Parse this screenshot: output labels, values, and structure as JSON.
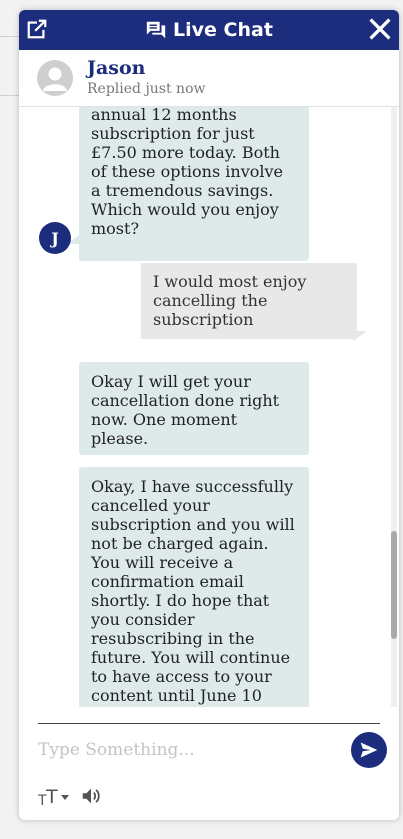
{
  "header": {
    "title": "Live Chat",
    "popout_icon": "popout-icon",
    "chat_icon": "chat-bubbles-icon",
    "close_icon": "close-icon",
    "color": "#1c2d7d"
  },
  "agent": {
    "name": "Jason",
    "status": "Replied just now",
    "initial": "J"
  },
  "messages": [
    {
      "from": "agent",
      "text": "annual 12 months\nsubscription for just\n£7.50 more today. Both\nof these options involve\na tremendous savings.\nWhich would you enjoy\nmost?"
    },
    {
      "from": "user",
      "text": "I would most enjoy\ncancelling the\nsubscription"
    },
    {
      "from": "agent",
      "text": "Okay I will get your\ncancellation done right\nnow. One moment\nplease."
    },
    {
      "from": "agent",
      "text": "Okay, I have successfully\ncancelled your\nsubscription and you will\nnot be charged again.\nYou will receive a\nconfirmation email\nshortly. I do hope that\nyou consider\nresubscribing in the\nfuture. You will continue\nto have access to your\ncontent until June 10"
    }
  ],
  "composer": {
    "placeholder": "Type Something...",
    "send_icon": "send-icon",
    "text_size_icon": "text-size-icon",
    "sound_icon": "speaker-icon"
  },
  "colors": {
    "agent_bubble": "#deeaea",
    "user_bubble": "#e8e8e8",
    "accent": "#1c2d7d"
  }
}
